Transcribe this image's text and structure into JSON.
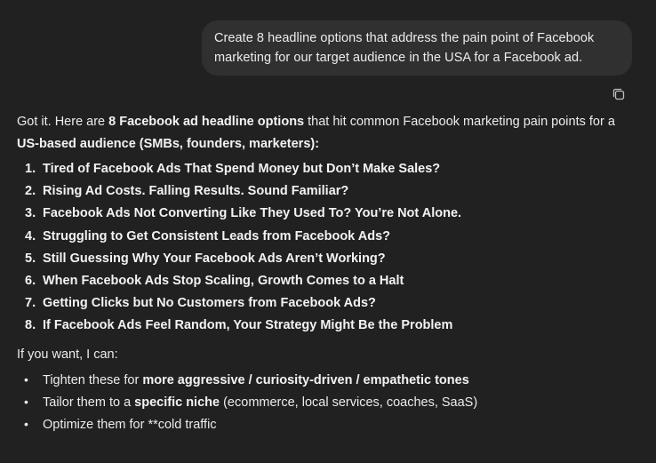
{
  "user_message": {
    "text": "Create 8 headline options that address the pain point of Facebook marketing for our target audience in the USA for a Facebook ad."
  },
  "copy_button": {
    "icon": "copy-icon"
  },
  "assistant": {
    "intro": {
      "part1": "Got it. Here are ",
      "bold1": "8 Facebook ad headline options",
      "part2": " that hit common Facebook marketing pain points for a ",
      "bold2": "US-based audience (SMBs, founders, marketers):"
    },
    "headlines": [
      {
        "num": "1.",
        "text": "Tired of Facebook Ads That Spend Money but Don’t Make Sales?"
      },
      {
        "num": "2.",
        "text": "Rising Ad Costs. Falling Results. Sound Familiar?"
      },
      {
        "num": "3.",
        "text": "Facebook Ads Not Converting Like They Used To? You’re Not Alone."
      },
      {
        "num": "4.",
        "text": "Struggling to Get Consistent Leads from Facebook Ads?"
      },
      {
        "num": "5.",
        "text": "Still Guessing Why Your Facebook Ads Aren’t Working?"
      },
      {
        "num": "6.",
        "text": "When Facebook Ads Stop Scaling, Growth Comes to a Halt"
      },
      {
        "num": "7.",
        "text": "Getting Clicks but No Customers from Facebook Ads?"
      },
      {
        "num": "8.",
        "text": "If Facebook Ads Feel Random, Your Strategy Might Be the Problem"
      }
    ],
    "if_want": "If you want, I can:",
    "options": [
      {
        "pre": "Tighten these for ",
        "bold": "more aggressive / curiosity-driven / empathetic tones",
        "post": ""
      },
      {
        "pre": "Tailor them to a ",
        "bold": "specific niche",
        "post": " (ecommerce, local services, coaches, SaaS)"
      },
      {
        "pre": "Optimize them for **cold traffic",
        "bold": "",
        "post": ""
      }
    ],
    "bullet": "•"
  },
  "colors": {
    "background": "#212121",
    "user_bubble": "#303030",
    "text": "#ececec"
  }
}
